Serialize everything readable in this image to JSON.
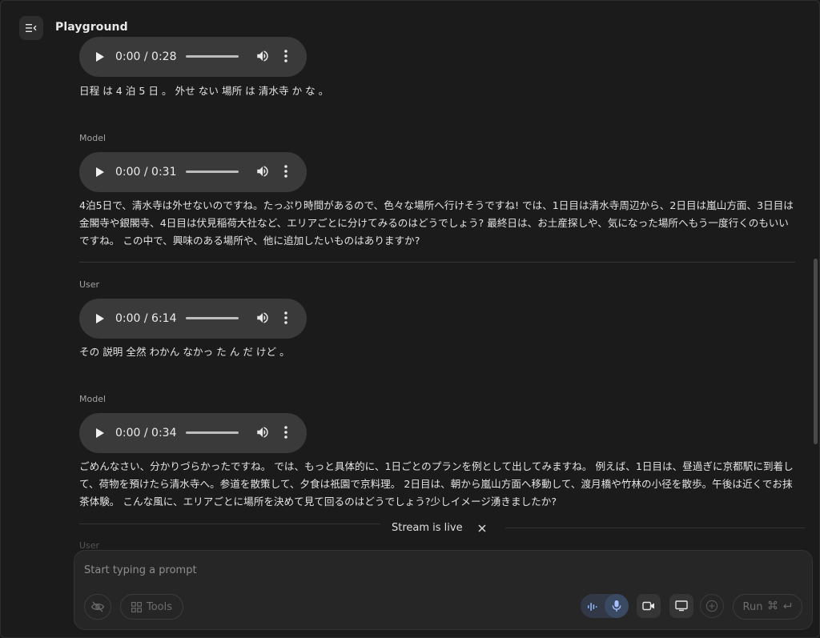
{
  "app": {
    "title": "Playground"
  },
  "icons": {
    "menu": "menu-collapse-icon",
    "play": "play-icon",
    "volume": "volume-icon",
    "more": "more-vert-icon",
    "close": "close-icon",
    "hide": "eye-off-icon",
    "tools": "grid-icon",
    "waveform": "waveform-icon",
    "mic": "mic-icon",
    "camera": "video-camera-icon",
    "screen": "screen-share-icon",
    "add": "add-circle-icon",
    "command": "command-icon",
    "enter": "enter-icon"
  },
  "chat": {
    "messages": [
      {
        "role": "",
        "audio_time": "0:00 / 0:28",
        "text": "日程 は 4 泊 5 日 。 外せ ない 場所 は 清水寺 か な 。"
      },
      {
        "role": "Model",
        "audio_time": "0:00 / 0:31",
        "text": "4泊5日で、清水寺は外せないのですね。たっぷり時間があるので、色々な場所へ行けそうですね! では、1日目は清水寺周辺から、2日目は嵐山方面、3日目は金閣寺や銀閣寺、4日目は伏見稲荷大社など、エリアごとに分けてみるのはどうでしょう? 最終日は、お土産探しや、気になった場所へもう一度行くのもいいですね。 この中で、興味のある場所や、他に追加したいものはありますか?"
      },
      {
        "role": "User",
        "audio_time": "0:00 / 6:14",
        "text": "その 説明 全然 わかん なかっ た ん だ けど 。"
      },
      {
        "role": "Model",
        "audio_time": "0:00 / 0:34",
        "text": "ごめんなさい、分かりづらかったですね。 では、もっと具体的に、1日ごとのプランを例として出してみますね。 例えば、1日目は、昼過ぎに京都駅に到着して、荷物を預けたら清水寺へ。参道を散策して、夕食は祇園で京料理。 2日目は、朝から嵐山方面へ移動して、渡月橋や竹林の小径を散歩。午後は近くでお抹茶体験。 こんな風に、エリアごとに場所を決めて見て回るのはどうでしょう?少しイメージ湧きましたか?"
      }
    ],
    "next_role": "User"
  },
  "stream": {
    "status": "Stream is live"
  },
  "composer": {
    "placeholder": "Start typing a prompt",
    "value": "",
    "tools_label": "Tools",
    "run_label": "Run"
  },
  "colors": {
    "background": "#1b1b1b",
    "audio_player": "#3a3a3a",
    "mic_active": "#3b4a63",
    "mic_icon": "#a9c1ff",
    "waveform": "#8ab4f8"
  }
}
